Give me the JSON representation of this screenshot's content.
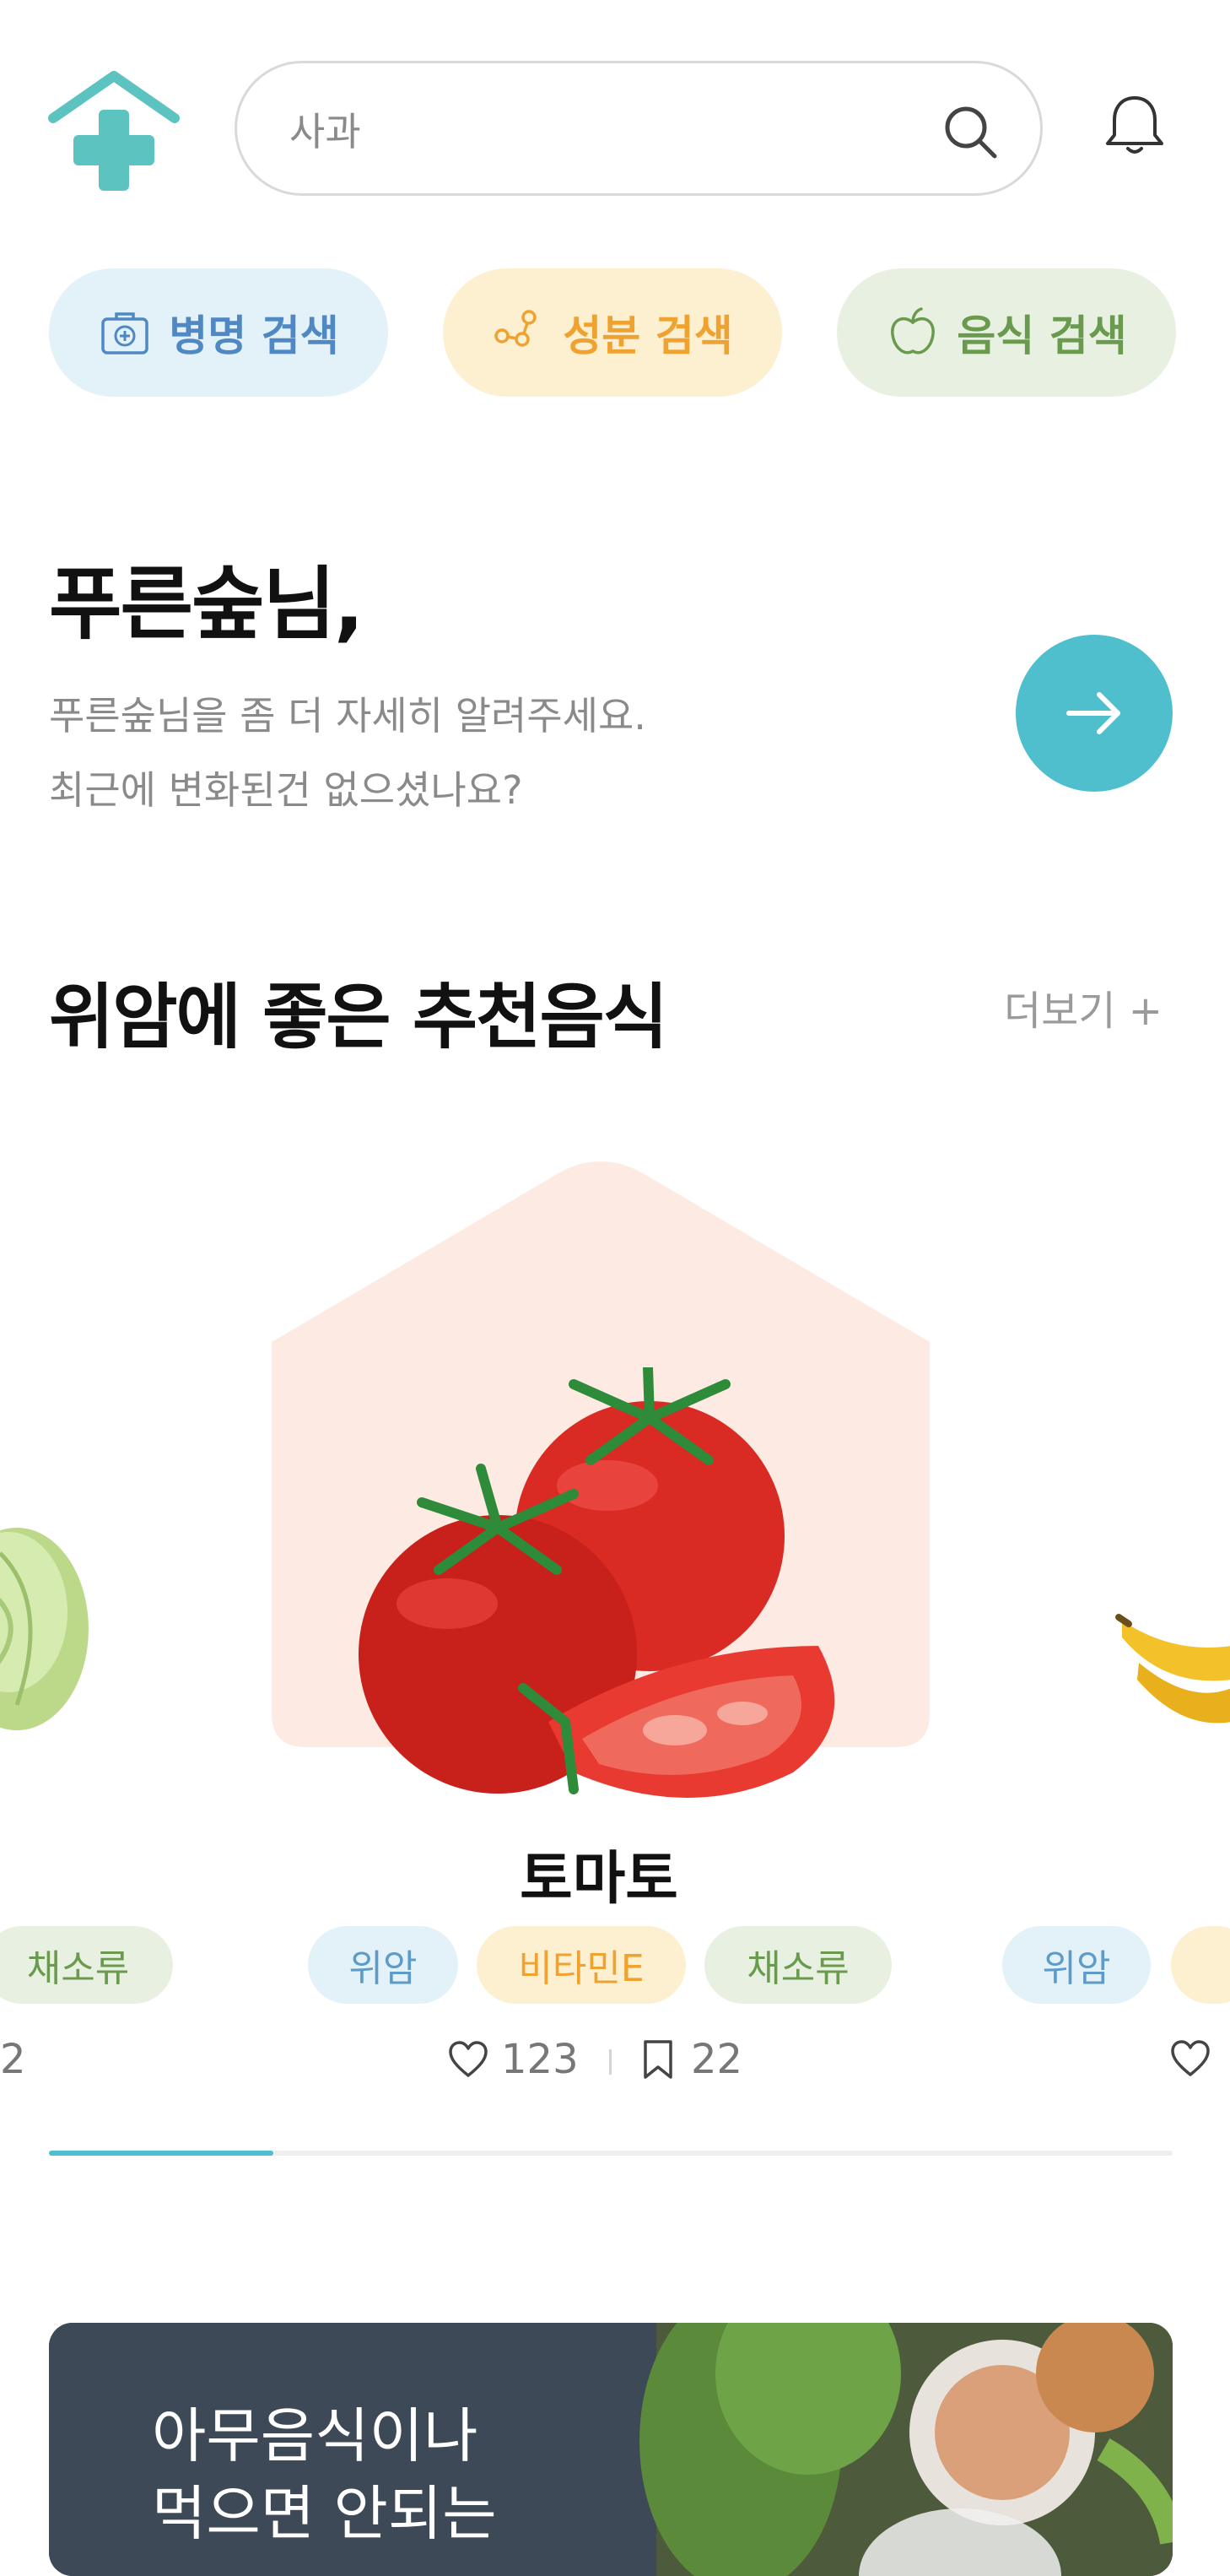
{
  "header": {
    "search_placeholder": "사과",
    "icons": {
      "logo": "house-plus-logo",
      "search": "search-icon",
      "notifications": "bell-icon"
    }
  },
  "categories": [
    {
      "label": "병명 검색",
      "icon": "medical-kit-icon",
      "color": "#4f88c2"
    },
    {
      "label": "성분 검색",
      "icon": "molecule-icon",
      "color": "#f0a230"
    },
    {
      "label": "음식 검색",
      "icon": "apple-icon",
      "color": "#6a9a4e"
    }
  ],
  "greeting": {
    "title": "푸른숲님,",
    "line1": "푸른숲님을 좀 더 자세히 알려주세요.",
    "line2": "최근에 변화된건 없으셨나요?"
  },
  "recommend": {
    "title": "위암에 좋은 추천음식",
    "more_label": "더보기 +",
    "current": {
      "name": "토마토",
      "tags": [
        "위암",
        "비타민E",
        "채소류"
      ],
      "likes": "123",
      "bookmarks": "22"
    },
    "prev_partial": {
      "tag": "채소류",
      "count": "2"
    },
    "next_partial": {
      "tag": "위암"
    },
    "carousel_progress": 0.2
  },
  "banner": {
    "line1": "아무음식이나",
    "line2": "먹으면 안되는"
  },
  "colors": {
    "accent": "#4fbfcd",
    "card_bg": "#fdebe3"
  }
}
